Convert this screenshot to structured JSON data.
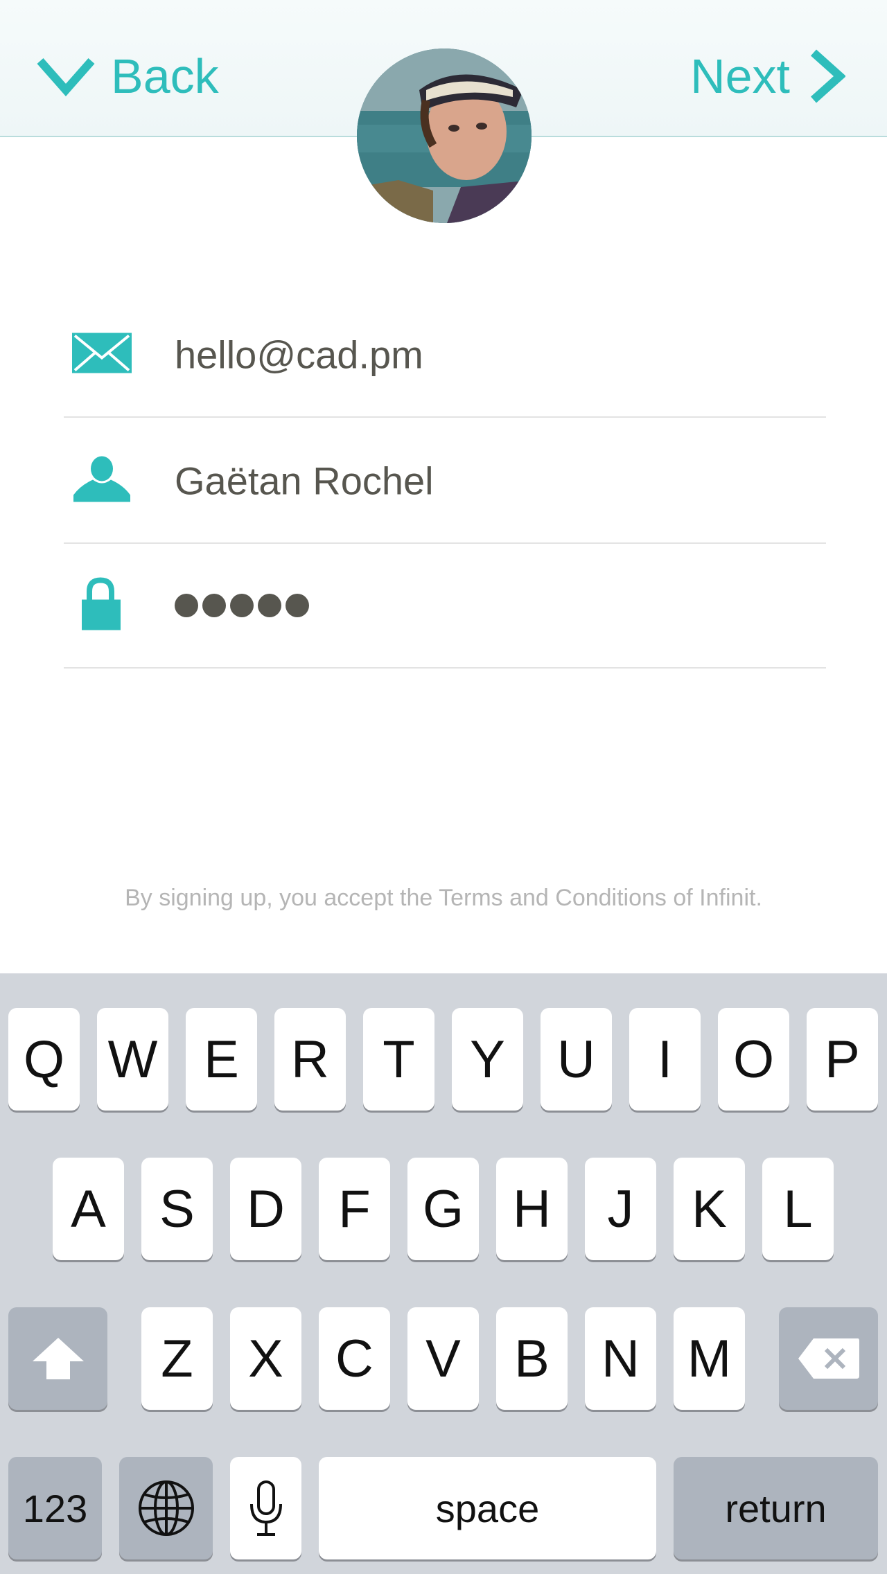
{
  "header": {
    "back_label": "Back",
    "next_label": "Next"
  },
  "form": {
    "email": {
      "icon": "envelope-icon",
      "value": "hello@cad.pm"
    },
    "name": {
      "icon": "person-icon",
      "value": "Gaëtan Rochel"
    },
    "password": {
      "icon": "lock-icon",
      "masked_length": 5
    }
  },
  "terms_text": "By signing up, you accept the Terms and Conditions of Infinit.",
  "keyboard": {
    "row1": [
      "Q",
      "W",
      "E",
      "R",
      "T",
      "Y",
      "U",
      "I",
      "O",
      "P"
    ],
    "row2": [
      "A",
      "S",
      "D",
      "F",
      "G",
      "H",
      "J",
      "K",
      "L"
    ],
    "row3": [
      "Z",
      "X",
      "C",
      "V",
      "B",
      "N",
      "M"
    ],
    "numbers_label": "123",
    "space_label": "space",
    "return_label": "return"
  },
  "colors": {
    "accent": "#2ebdbb",
    "text": "#57564f",
    "keyboard_bg": "#d1d5db"
  }
}
